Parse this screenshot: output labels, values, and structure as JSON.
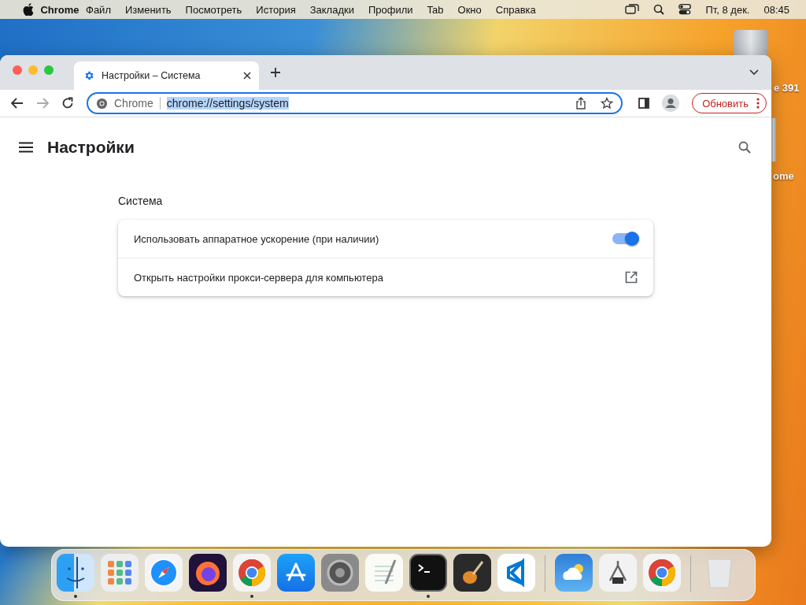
{
  "menubar": {
    "app": "Chrome",
    "items": [
      "Файл",
      "Изменить",
      "Посмотреть",
      "История",
      "Закладки",
      "Профили",
      "Tab",
      "Окно",
      "Справка"
    ],
    "date": "Пт, 8 дек.",
    "time": "08:45"
  },
  "desktop_icons": [
    {
      "label": "e 391"
    },
    {
      "label": "ome"
    }
  ],
  "browser": {
    "tab": {
      "title": "Настройки – Система",
      "selected": true
    },
    "omnibox": {
      "site": "Chrome",
      "url": "chrome://settings/system",
      "url_selected": true
    },
    "update_button": "Обновить"
  },
  "settings": {
    "title": "Настройки",
    "section": "Система",
    "rows": [
      {
        "kind": "toggle",
        "label": "Использовать аппаратное ускорение (при наличии)",
        "on": true
      },
      {
        "kind": "link",
        "label": "Открыть настройки прокси-сервера для компьютера"
      }
    ]
  },
  "dock": [
    {
      "kind": "finder",
      "running": true
    },
    {
      "kind": "launchpad",
      "running": false
    },
    {
      "kind": "safari",
      "running": false
    },
    {
      "kind": "firefox",
      "running": false
    },
    {
      "kind": "chrome",
      "running": true
    },
    {
      "kind": "appstore",
      "running": false
    },
    {
      "kind": "settings",
      "running": false
    },
    {
      "kind": "textedit",
      "running": false
    },
    {
      "kind": "terminal",
      "running": true
    },
    {
      "kind": "garageband",
      "running": false
    },
    {
      "kind": "vscode",
      "running": false
    },
    {
      "kind": "separator"
    },
    {
      "kind": "weather",
      "running": false
    },
    {
      "kind": "utility",
      "running": false
    },
    {
      "kind": "chrome",
      "running": false
    },
    {
      "kind": "separator"
    },
    {
      "kind": "trash",
      "running": false
    }
  ]
}
